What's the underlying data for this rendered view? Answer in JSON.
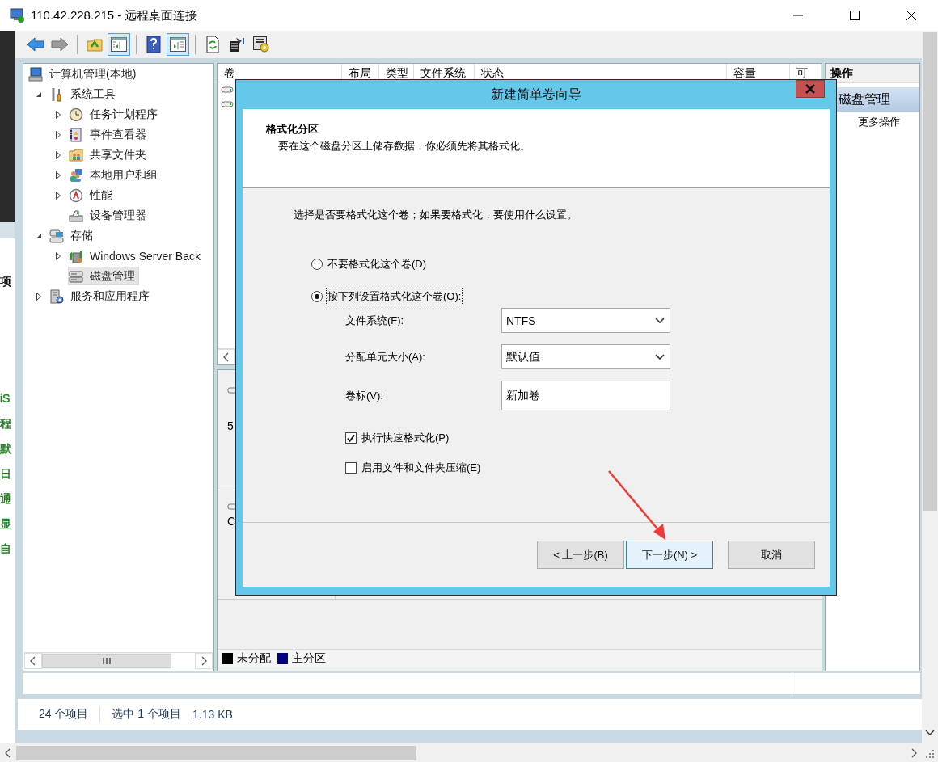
{
  "window": {
    "title": "110.42.228.215 - 远程桌面连接"
  },
  "background_fragments": [
    {
      "text": "项",
      "color": "#000000"
    },
    {
      "text": "iS",
      "color": "#1a7a1a"
    },
    {
      "text": "程",
      "color": "#1a7a1a"
    },
    {
      "text": "默",
      "color": "#1a7a1a"
    },
    {
      "text": "日",
      "color": "#1a7a1a"
    },
    {
      "text": "通",
      "color": "#1a7a1a"
    },
    {
      "text": "显",
      "color": "#1a7a1a"
    },
    {
      "text": "自",
      "color": "#1a7a1a"
    }
  ],
  "toolbar": [
    {
      "kind": "back",
      "pressed": false
    },
    {
      "kind": "forward",
      "pressed": false
    },
    {
      "kind": "up",
      "pressed": false
    },
    {
      "kind": "tree",
      "pressed": true
    },
    {
      "kind": "help",
      "pressed": false
    },
    {
      "kind": "actionpane",
      "pressed": true
    },
    {
      "kind": "refresh",
      "pressed": false
    },
    {
      "kind": "export",
      "pressed": false
    },
    {
      "kind": "properties",
      "pressed": false
    }
  ],
  "tree": {
    "items": [
      {
        "label": "计算机管理(本地)",
        "kind": "computer",
        "selected": false,
        "children": [
          {
            "label": "系统工具",
            "kind": "tools",
            "expanded": true,
            "selected": false,
            "children": [
              {
                "label": "任务计划程序",
                "kind": "clock",
                "expanded": false,
                "selected": false
              },
              {
                "label": "事件查看器",
                "kind": "event",
                "expanded": false,
                "selected": false
              },
              {
                "label": "共享文件夹",
                "kind": "share",
                "expanded": false,
                "selected": false
              },
              {
                "label": "本地用户和组",
                "kind": "users",
                "expanded": false,
                "selected": false
              },
              {
                "label": "性能",
                "kind": "perf",
                "expanded": false,
                "selected": false
              },
              {
                "label": "设备管理器",
                "kind": "device",
                "selected": false
              }
            ]
          },
          {
            "label": "存储",
            "kind": "storage",
            "expanded": true,
            "selected": false,
            "children": [
              {
                "label": "Windows Server Back",
                "kind": "backup",
                "expanded": false,
                "selected": false
              },
              {
                "label": "磁盘管理",
                "kind": "disk",
                "selected": true
              }
            ]
          },
          {
            "label": "服务和应用程序",
            "kind": "services",
            "expanded": false,
            "selected": false
          }
        ]
      }
    ]
  },
  "volume_table": {
    "columns": [
      "卷",
      "布局",
      "类型",
      "文件系统",
      "状态",
      "容量",
      "可"
    ]
  },
  "disks": [
    {
      "lines": [
        "5"
      ]
    },
    {
      "lines": [
        "C"
      ]
    }
  ],
  "legend": [
    {
      "label": "未分配",
      "color": "#000000"
    },
    {
      "label": "主分区",
      "color": "#000080"
    }
  ],
  "actions": {
    "title": "操作",
    "items": [
      {
        "label": "磁盘管理",
        "kind": "section"
      },
      {
        "label": "更多操作",
        "kind": "action"
      }
    ]
  },
  "status_bar": {
    "count": "24 个项目",
    "selection": "选中 1 个项目",
    "size": "1.13 KB"
  },
  "dialog": {
    "title": "新建简单卷向导",
    "heading": "格式化分区",
    "subheading": "要在这个磁盘分区上储存数据，你必须先将其格式化。",
    "prompt": "选择是否要格式化这个卷；如果要格式化，要使用什么设置。",
    "options": [
      {
        "label": "不要格式化这个卷(D)",
        "selected": false
      },
      {
        "label": "按下列设置格式化这个卷(O):",
        "selected": true
      }
    ],
    "fields": [
      {
        "label": "文件系统(F):",
        "kind": "dropdown",
        "value": "NTFS"
      },
      {
        "label": "分配单元大小(A):",
        "kind": "dropdown",
        "value": "默认值"
      },
      {
        "label": "卷标(V):",
        "kind": "text",
        "value": "新加卷"
      }
    ],
    "checkboxes": [
      {
        "label": "执行快速格式化(P)",
        "checked": true
      },
      {
        "label": "启用文件和文件夹压缩(E)",
        "checked": false
      }
    ],
    "buttons": [
      {
        "label": "< 上一步(B)",
        "focused": false
      },
      {
        "label": "下一步(N) >",
        "focused": true
      },
      {
        "label": "取消",
        "focused": false
      }
    ]
  }
}
